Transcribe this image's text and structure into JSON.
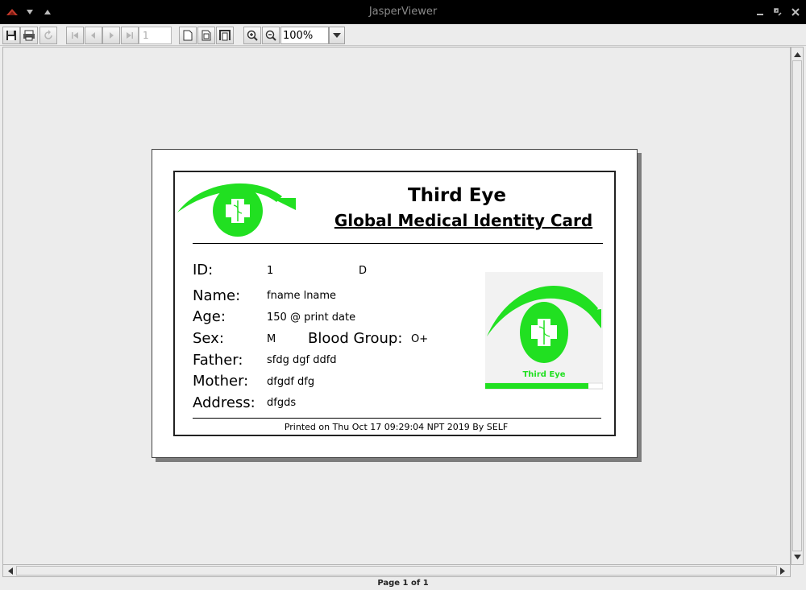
{
  "window": {
    "title": "JasperViewer"
  },
  "toolbar": {
    "page_number": "1",
    "zoom": "100%"
  },
  "card": {
    "title": "Third Eye",
    "subtitle": "Global Medical Identity Card",
    "fields": {
      "id_label": "ID:",
      "id_value": "1",
      "id_extra": "D",
      "name_label": "Name:",
      "name_value": "fname lname",
      "age_label": "Age:",
      "age_value": "150 @ print date",
      "sex_label": "Sex:",
      "sex_value": "M",
      "blood_label": "Blood Group:",
      "blood_value": "O+",
      "father_label": "Father:",
      "father_value": "sfdg dgf ddfd",
      "mother_label": "Mother:",
      "mother_value": "dfgdf dfg",
      "address_label": "Address:",
      "address_value": "dfgds"
    },
    "photo_caption": "Third Eye",
    "footer": "Printed on Thu Oct 17 09:29:04 NPT 2019 By SELF"
  },
  "status": {
    "page_info": "Page 1 of 1"
  },
  "colors": {
    "brand_green": "#21e021",
    "titlebar": "#000000"
  }
}
